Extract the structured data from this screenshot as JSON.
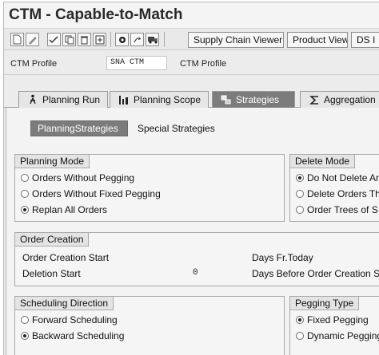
{
  "window": {
    "title": "CTM - Capable-to-Match"
  },
  "toolbar": {
    "icons": [
      "new-icon",
      "edit-icon",
      "check-icon",
      "copy-icon",
      "delete-icon",
      "transport-icon",
      "settings-icon",
      "execute-icon",
      "truck-icon"
    ],
    "buttons": {
      "supply_chain_viewer": "Supply Chain Viewer",
      "product_view": "Product View",
      "ds": "DS I"
    }
  },
  "profile": {
    "label": "CTM Profile",
    "value": "SNA CTM",
    "description": "CTM Profile"
  },
  "tabs": [
    {
      "label": "Planning Run",
      "icon": "person-run-icon"
    },
    {
      "label": "Planning Scope",
      "icon": "bar-chart-icon"
    },
    {
      "label": "Strategies",
      "icon": "strategies-icon",
      "active": true
    },
    {
      "label": "Aggregation",
      "icon": "sigma-icon"
    }
  ],
  "subtabs": [
    {
      "label": "PlanningStrategies",
      "active": true
    },
    {
      "label": "Special Strategies"
    }
  ],
  "planning_mode": {
    "title": "Planning Mode",
    "options": [
      {
        "label": "Orders Without Pegging",
        "selected": false
      },
      {
        "label": "Orders Without Fixed Pegging",
        "selected": false
      },
      {
        "label": "Replan All Orders",
        "selected": true
      }
    ]
  },
  "delete_mode": {
    "title": "Delete Mode",
    "options": [
      {
        "label": "Do Not Delete Ar",
        "selected": true
      },
      {
        "label": "Delete Orders Th",
        "selected": false
      },
      {
        "label": "Order Trees of S",
        "selected": false
      }
    ]
  },
  "order_creation": {
    "title": "Order Creation",
    "creation_start_label": "Order Creation Start",
    "creation_start_unit": "Days Fr.Today",
    "deletion_start_label": "Deletion Start",
    "deletion_start_value": "0",
    "deletion_start_unit": "Days Before Order Creation Sta"
  },
  "scheduling_direction": {
    "title": "Scheduling Direction",
    "options": [
      {
        "label": "Forward Scheduling",
        "selected": false
      },
      {
        "label": "Backward Scheduling",
        "selected": true
      }
    ]
  },
  "pegging_type": {
    "title": "Pegging Type",
    "options": [
      {
        "label": "Fixed Pegging",
        "selected": true
      },
      {
        "label": "Dynamic Pegging",
        "selected": false
      }
    ]
  }
}
